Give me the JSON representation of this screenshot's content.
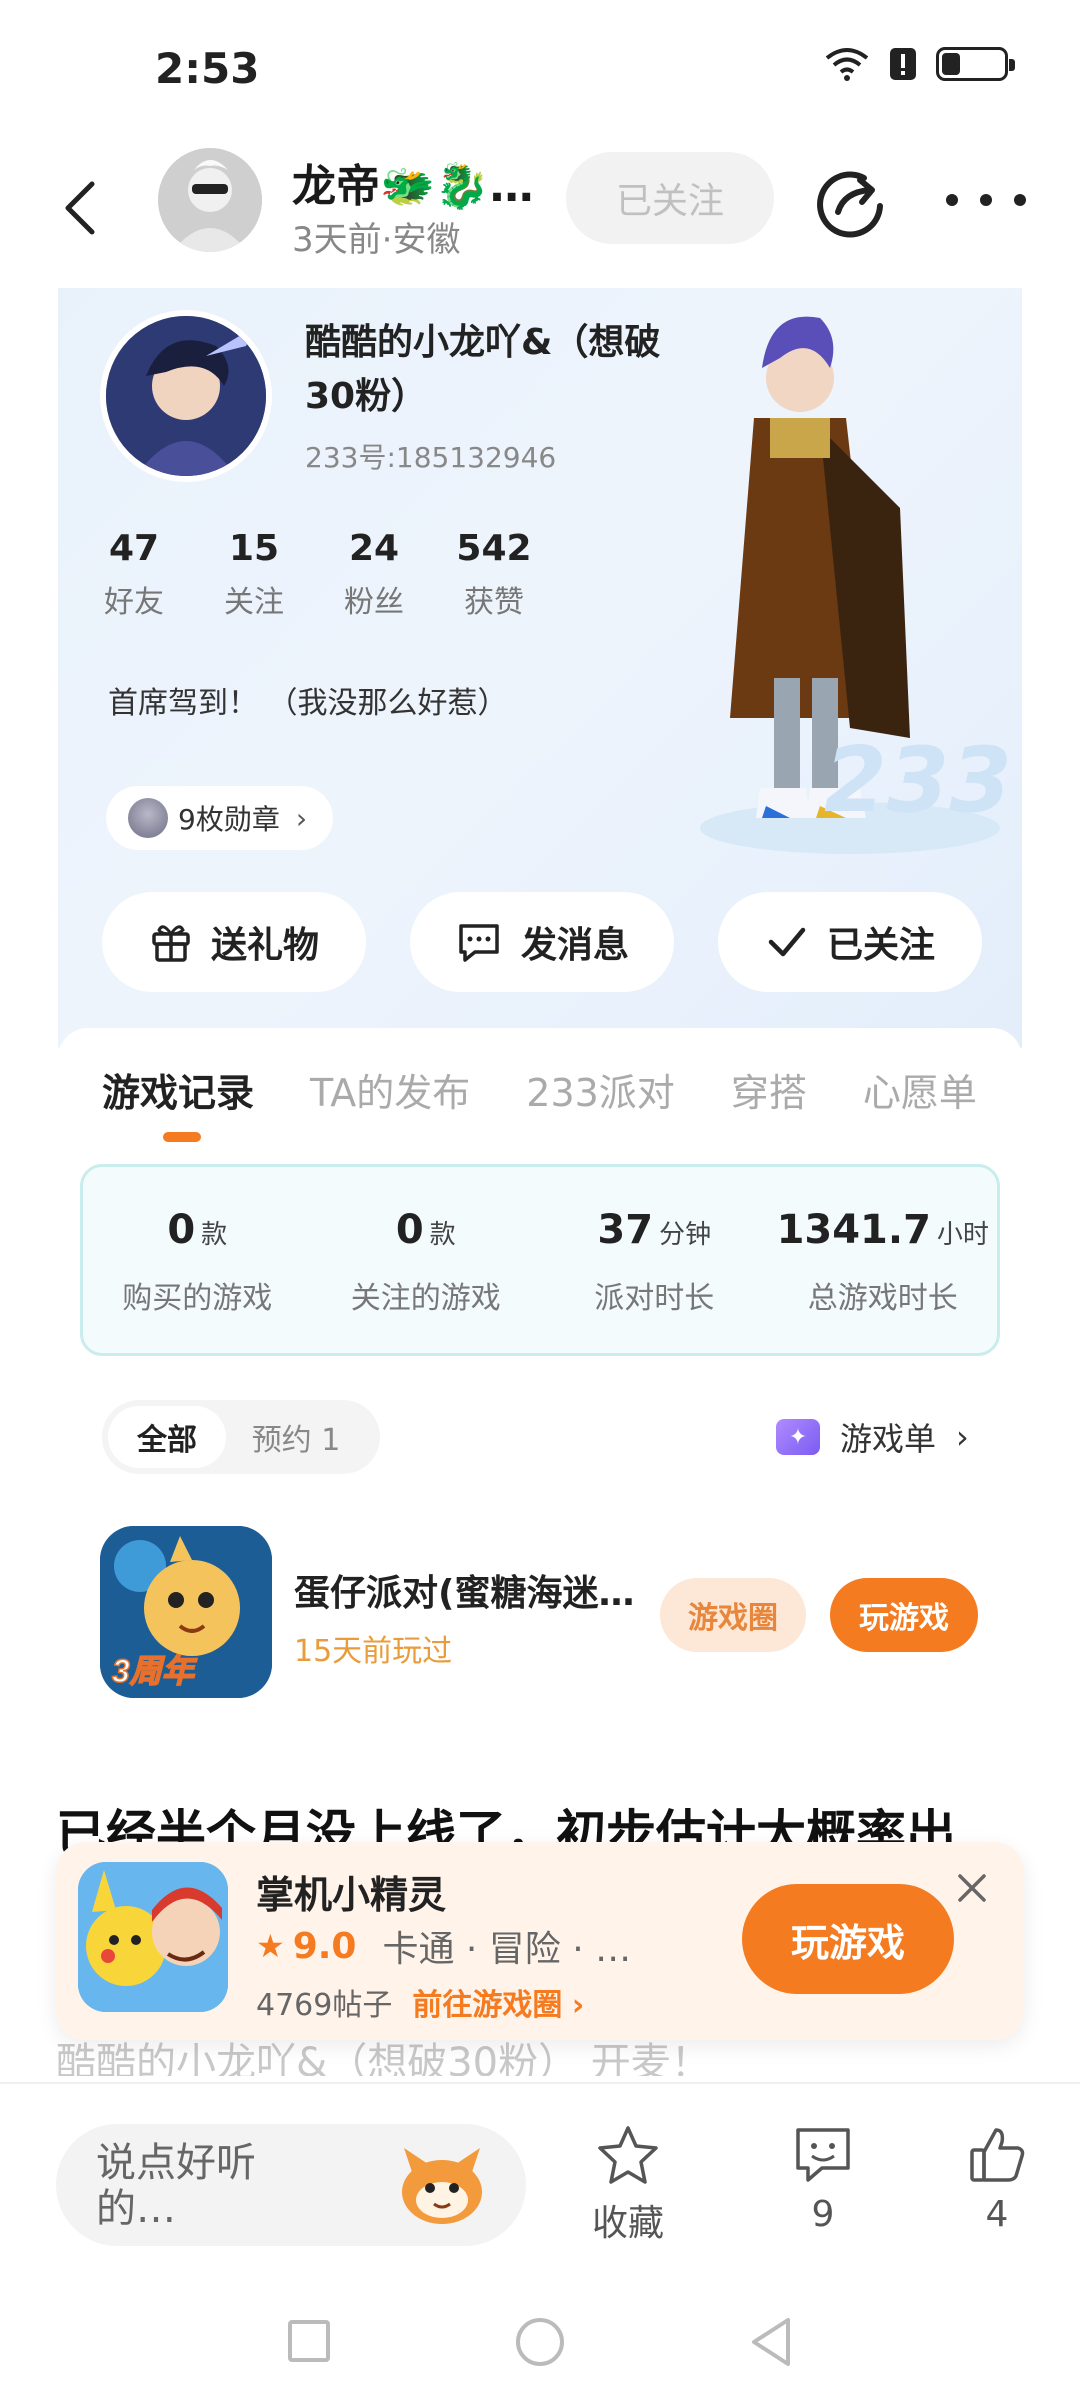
{
  "status_bar": {
    "time": "2:53",
    "battery_level": 0.3
  },
  "header": {
    "username": "龙帝🐲🐉…",
    "subtitle": "3天前·安徽",
    "follow_label": "已关注"
  },
  "profile": {
    "name": "酷酷的小龙吖&（想破30粉）",
    "id_text": "233号:185132946",
    "stats": [
      {
        "value": "47",
        "label": "好友"
      },
      {
        "value": "15",
        "label": "关注"
      },
      {
        "value": "24",
        "label": "粉丝"
      },
      {
        "value": "542",
        "label": "获赞"
      }
    ],
    "bio": "首席驾到！ （我没那么好惹）",
    "medals_label": "9枚勋章",
    "stage_badge": "233",
    "actions": {
      "gift": "送礼物",
      "message": "发消息",
      "followed": "已关注"
    }
  },
  "tabs": [
    "游戏记录",
    "TA的发布",
    "233派对",
    "穿搭",
    "心愿单"
  ],
  "game_stats": [
    {
      "value": "0",
      "unit": "款",
      "label": "购买的游戏"
    },
    {
      "value": "0",
      "unit": "款",
      "label": "关注的游戏"
    },
    {
      "value": "37",
      "unit": "分钟",
      "label": "派对时长"
    },
    {
      "value": "1341.7",
      "unit": "小时",
      "label": "总游戏时长"
    }
  ],
  "filter": {
    "all": "全部",
    "reserved": "预约 1",
    "game_list": "游戏单"
  },
  "game": {
    "title": "蛋仔派对(蜜糖海迷…",
    "subtitle": "15天前玩过",
    "circle_label": "游戏圈",
    "play_label": "玩游戏",
    "icon_badge": "3周年"
  },
  "post": {
    "title": "已经半个月没上线了，初步估计大概率出",
    "line": "酷酷的小龙吖&（想破30粉） 开麦！"
  },
  "promo": {
    "title": "掌机小精灵",
    "score": "9.0",
    "tags": "卡通 · 冒险 · 休…",
    "posts": "4769帖子",
    "link": "前往游戏圈",
    "play_label": "玩游戏"
  },
  "bottom_bar": {
    "comment_placeholder": "说点好听的…",
    "favorite_label": "收藏",
    "comments_count": "9",
    "likes_count": "4"
  }
}
